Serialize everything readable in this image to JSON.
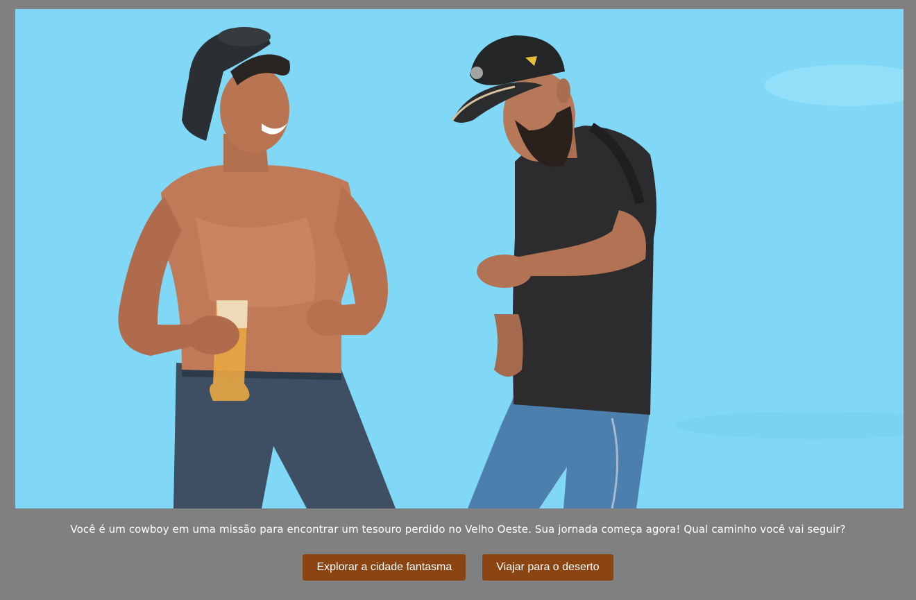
{
  "scene": {
    "image_label": "",
    "colors": {
      "sky": "#7fd8f6",
      "button": "#8b4513",
      "page_background": "#808080"
    }
  },
  "story": {
    "text": "Você é um cowboy em uma missão para encontrar um tesouro perdido no Velho Oeste. Sua jornada começa agora! Qual caminho você vai seguir?"
  },
  "choices": [
    {
      "label": "Explorar a cidade fantasma"
    },
    {
      "label": "Viajar para o deserto"
    }
  ]
}
